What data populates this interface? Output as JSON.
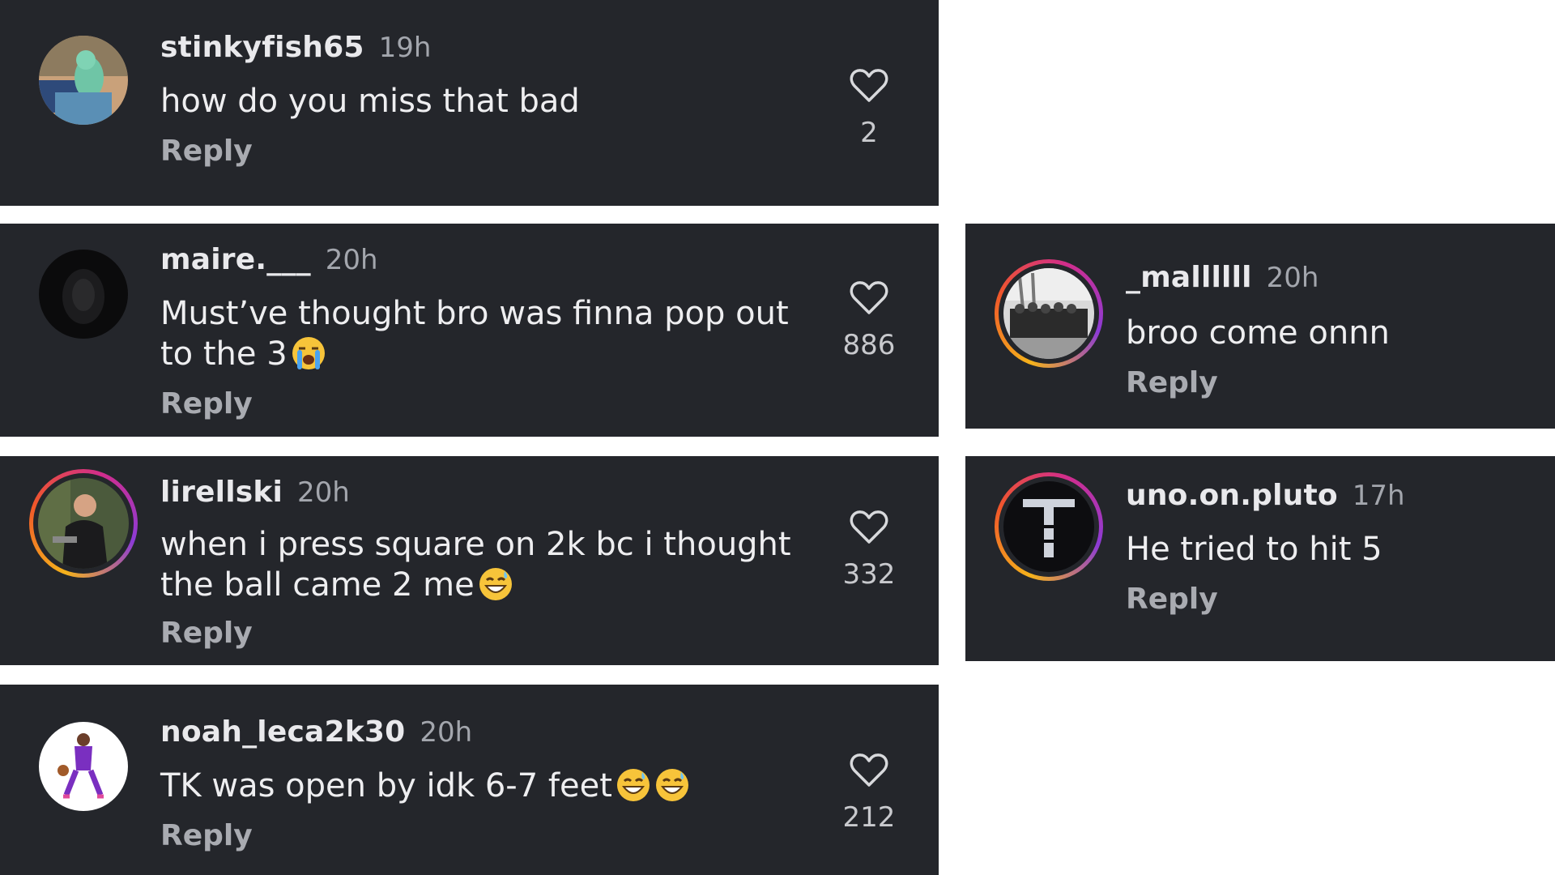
{
  "comments": [
    {
      "username": "stinkyfish65",
      "time": "19h",
      "text": "how do you miss that bad",
      "reply_label": "Reply",
      "likes": "2",
      "avatar_icon": "squidward-avatar-icon"
    },
    {
      "username": "maire.___",
      "time": "20h",
      "text": "Must’ve thought bro was finna pop out to the 3",
      "reply_label": "Reply",
      "likes": "886",
      "emoji": "loudly-crying-face-emoji"
    },
    {
      "username": "lirellski",
      "time": "20h",
      "text": "when i press square on 2k bc i thought the ball came 2 me",
      "reply_label": "Reply",
      "likes": "332",
      "emoji": "grinning-sweat-face-emoji"
    },
    {
      "username": "noah_leca2k30",
      "time": "20h",
      "text": "TK was open by idk 6-7 feet",
      "reply_label": "Reply",
      "likes": "212",
      "emoji": "grinning-sweat-face-emoji x2"
    },
    {
      "username": "_mallllll",
      "time": "20h",
      "text": "broo come onnn",
      "reply_label": "Reply"
    },
    {
      "username": "uno.on.pluto",
      "time": "17h",
      "text": "He tried to hit 5",
      "reply_label": "Reply"
    }
  ],
  "colors": {
    "card_bg": "#24262b",
    "username": "#e9e9ec",
    "meta": "#a3a6ad",
    "ring_gradient": [
      "#f5b21b",
      "#f0572a",
      "#d12d8c",
      "#8c3bd6"
    ]
  }
}
